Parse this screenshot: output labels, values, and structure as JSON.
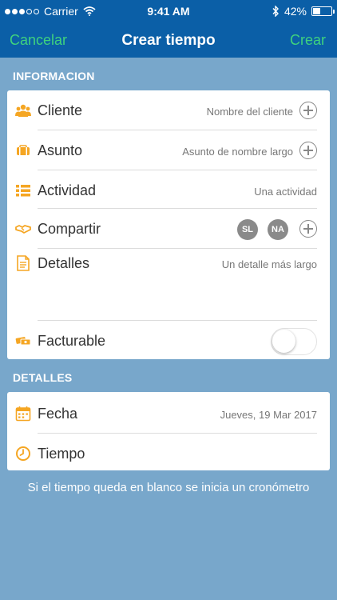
{
  "status_bar": {
    "carrier": "Carrier",
    "time": "9:41 AM",
    "battery": "42%",
    "battery_level": 0.42
  },
  "nav": {
    "cancel": "Cancelar",
    "title": "Crear tiempo",
    "create": "Crear"
  },
  "sections": {
    "informacion": "INFORMACION",
    "detalles": "DETALLES"
  },
  "informacion": {
    "cliente": {
      "label": "Cliente",
      "value": "Nombre del cliente"
    },
    "asunto": {
      "label": "Asunto",
      "value": "Asunto de nombre largo"
    },
    "actividad": {
      "label": "Actividad",
      "value": "Una actividad"
    },
    "compartir": {
      "label": "Compartir",
      "avatars": [
        "SL",
        "NA"
      ]
    },
    "detalles": {
      "label": "Detalles",
      "value": "Un detalle más largo"
    },
    "facturable": {
      "label": "Facturable",
      "on": false
    }
  },
  "detalles": {
    "fecha": {
      "label": "Fecha",
      "value": "Jueves, 19 Mar 2017"
    },
    "tiempo": {
      "label": "Tiempo"
    }
  },
  "footnote": "Si el tiempo queda en blanco se inicia un cronómetro",
  "colors": {
    "header_bg": "#0b5fa7",
    "page_bg": "#78a7cb",
    "accent_green": "#3fd27e",
    "icon_orange": "#f5a623"
  }
}
